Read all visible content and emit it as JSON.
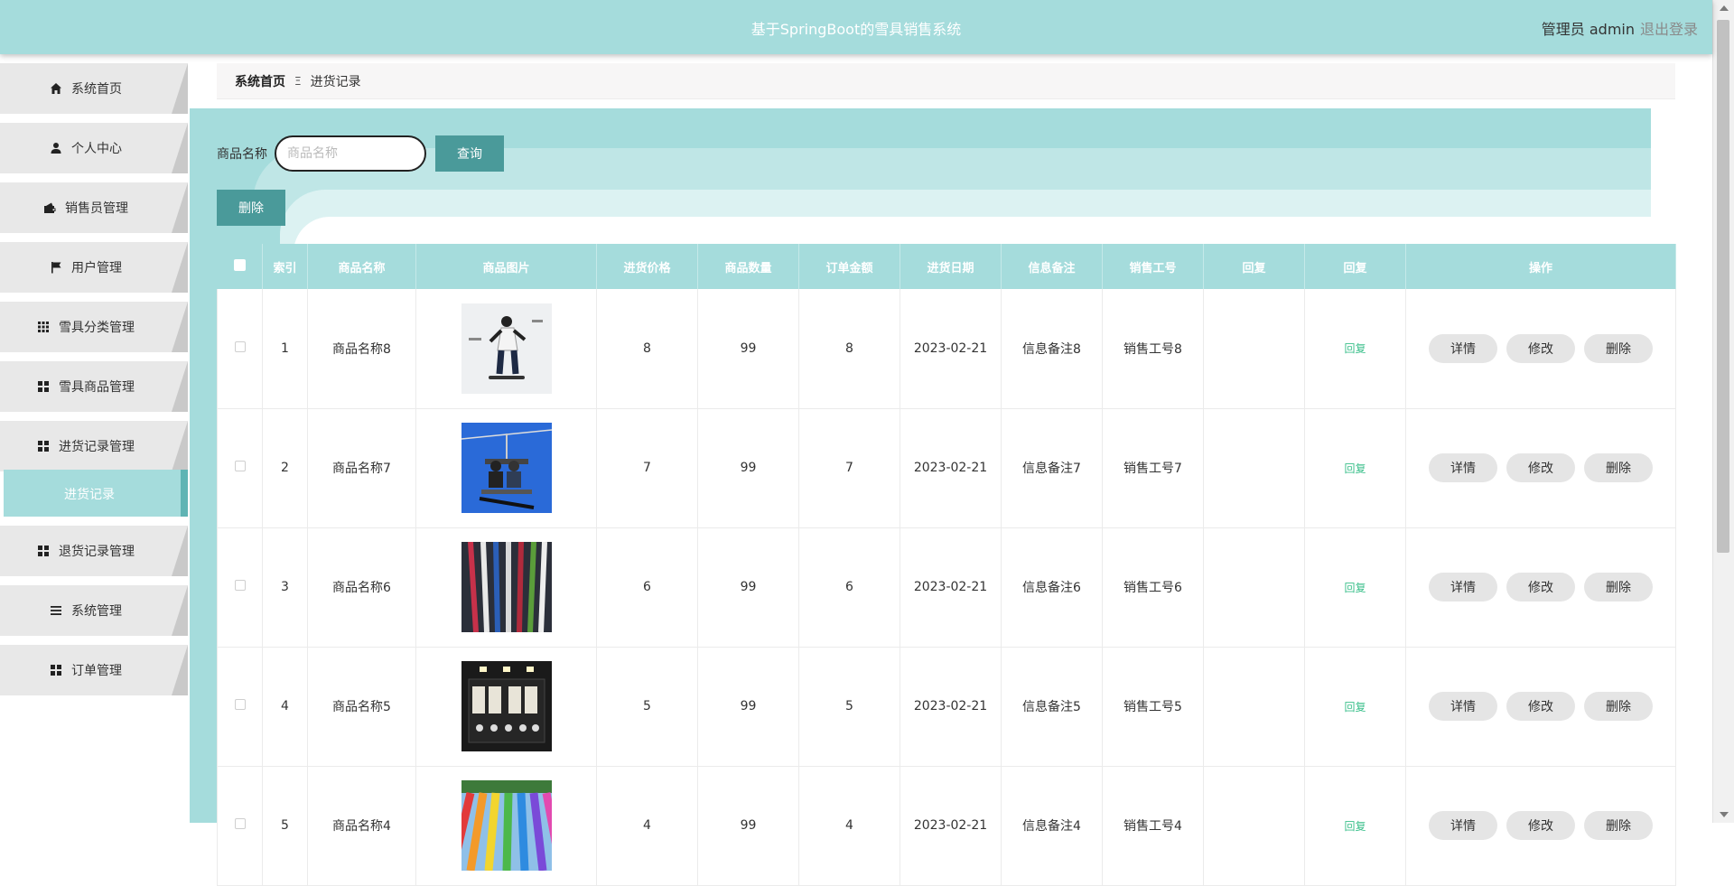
{
  "header": {
    "title": "基于SpringBoot的雪具销售系统",
    "user_label": "管理员 admin",
    "logout_label": "退出登录"
  },
  "sidebar": {
    "items": [
      {
        "label": "系统首页",
        "icon": "home-icon"
      },
      {
        "label": "个人中心",
        "icon": "person-icon"
      },
      {
        "label": "销售员管理",
        "icon": "wallet-icon"
      },
      {
        "label": "用户管理",
        "icon": "flag-icon"
      },
      {
        "label": "雪具分类管理",
        "icon": "grid-icon"
      },
      {
        "label": "雪具商品管理",
        "icon": "apps-icon"
      },
      {
        "label": "进货记录管理",
        "icon": "apps-icon"
      },
      {
        "label": "退货记录管理",
        "icon": "apps-icon"
      },
      {
        "label": "系统管理",
        "icon": "list-icon"
      },
      {
        "label": "订单管理",
        "icon": "apps-icon"
      }
    ],
    "active_sub": "进货记录"
  },
  "breadcrumb": {
    "home": "系统首页",
    "separator": "Ξ",
    "current": "进货记录"
  },
  "search": {
    "label": "商品名称",
    "placeholder": "商品名称",
    "button": "查询"
  },
  "batch_delete_label": "删除",
  "table": {
    "headers": [
      "索引",
      "商品名称",
      "商品图片",
      "进货价格",
      "商品数量",
      "订单金额",
      "进货日期",
      "信息备注",
      "销售工号",
      "回复",
      "回复",
      "操作"
    ],
    "rows": [
      {
        "index": "1",
        "name": "商品名称8",
        "image": "snowboarder",
        "price": "8",
        "qty": "99",
        "amount": "8",
        "date": "2023-02-21",
        "note": "信息备注8",
        "staff": "销售工号8",
        "reply_text": "",
        "reply_link": "回复"
      },
      {
        "index": "2",
        "name": "商品名称7",
        "image": "ski-lift",
        "price": "7",
        "qty": "99",
        "amount": "7",
        "date": "2023-02-21",
        "note": "信息备注7",
        "staff": "销售工号7",
        "reply_text": "",
        "reply_link": "回复"
      },
      {
        "index": "3",
        "name": "商品名称6",
        "image": "skis-rack",
        "price": "6",
        "qty": "99",
        "amount": "6",
        "date": "2023-02-21",
        "note": "信息备注6",
        "staff": "销售工号6",
        "reply_text": "",
        "reply_link": "回复"
      },
      {
        "index": "4",
        "name": "商品名称5",
        "image": "shop-sign",
        "price": "5",
        "qty": "99",
        "amount": "5",
        "date": "2023-02-21",
        "note": "信息备注5",
        "staff": "销售工号5",
        "reply_text": "",
        "reply_link": "回复"
      },
      {
        "index": "5",
        "name": "商品名称4",
        "image": "rainbow-slope",
        "price": "4",
        "qty": "99",
        "amount": "4",
        "date": "2023-02-21",
        "note": "信息备注4",
        "staff": "销售工号4",
        "reply_text": "",
        "reply_link": "回复"
      }
    ],
    "ops": {
      "detail": "详情",
      "edit": "修改",
      "delete": "删除"
    }
  },
  "colors": {
    "theme": "#a5dcdc",
    "button": "#4a9a9a",
    "reply_link": "#3cc08c"
  }
}
